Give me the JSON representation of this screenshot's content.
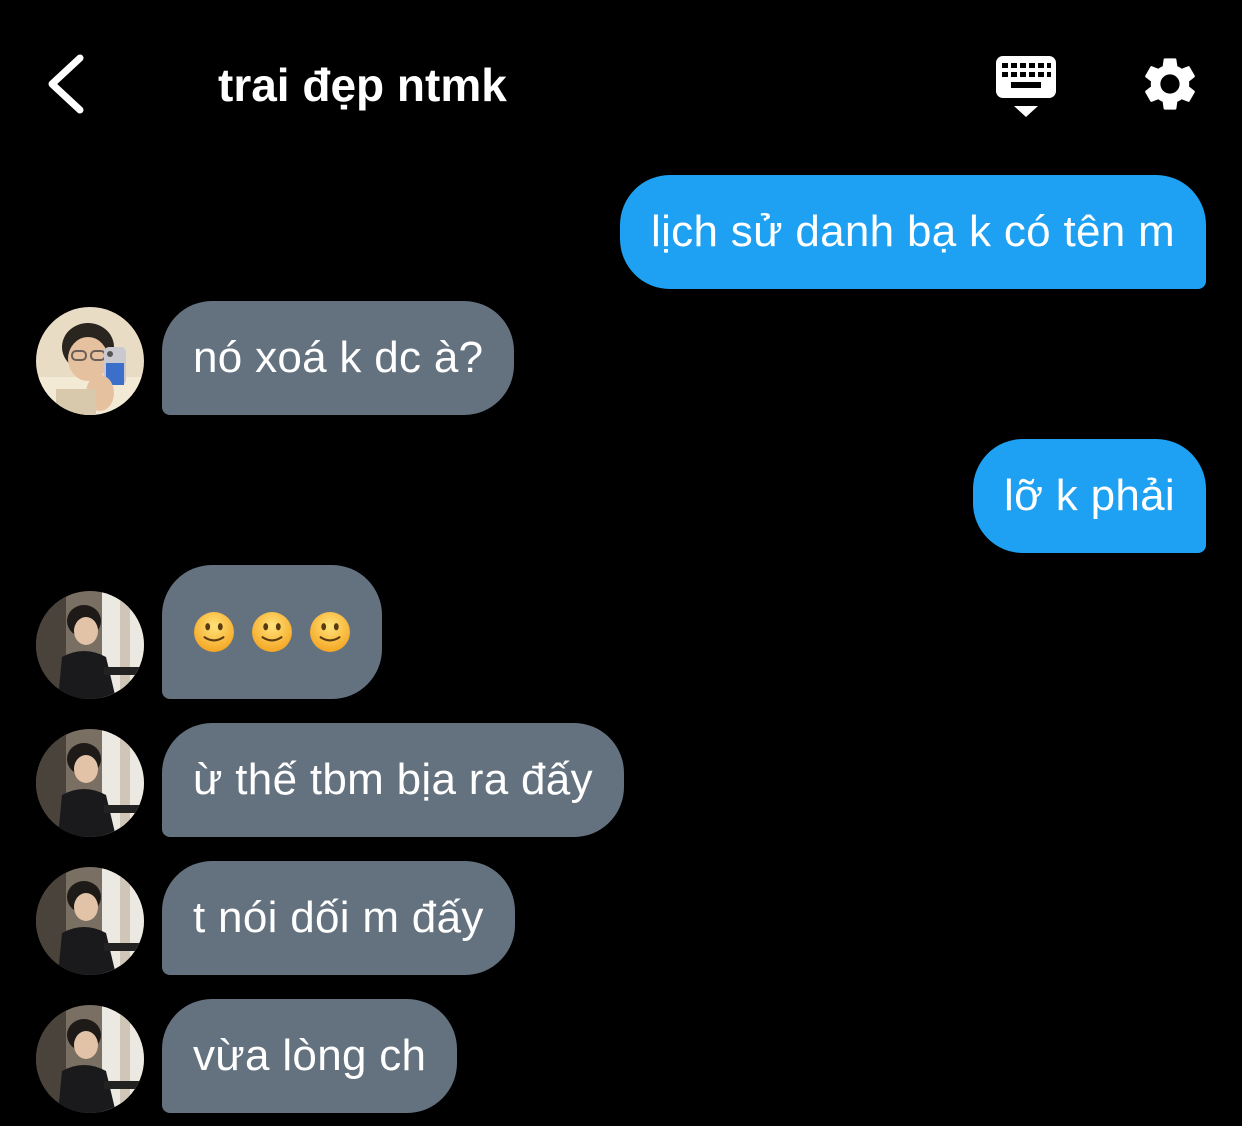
{
  "header": {
    "title": "trai đẹp ntmk",
    "back_icon": "chevron-left-icon",
    "keyboard_icon": "keyboard-icon",
    "settings_icon": "gear-icon"
  },
  "colors": {
    "background": "#000000",
    "sent_bubble": "#1ea1f2",
    "received_bubble": "#64727f"
  },
  "messages": [
    {
      "direction": "sent",
      "text": "lịch sử danh bạ k có tên m"
    },
    {
      "direction": "received",
      "text": "nó xoá k dc à?"
    },
    {
      "direction": "sent",
      "text": "lỡ k phải"
    },
    {
      "direction": "received",
      "text": "🙂🙂🙂"
    },
    {
      "direction": "received",
      "text": "ừ thế tbm bịa ra đấy"
    },
    {
      "direction": "received",
      "text": "t nói dối m đấy"
    },
    {
      "direction": "received",
      "text": "vừa lòng ch"
    }
  ]
}
